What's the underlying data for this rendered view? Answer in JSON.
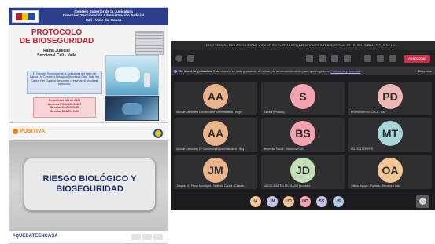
{
  "slide1": {
    "header_lines": [
      "Consejo Superior de la Judicatura",
      "Dirección Seccional de Administración Judicial",
      "Cali - Valle del Cauca"
    ],
    "title_lines": [
      "PROTOCOLO",
      "DE BIOSEGURIDAD"
    ],
    "rama_lines": [
      "Rama Judicial",
      "Seccional Cali - Valle"
    ],
    "blue_box_text": "El Consejo Seccional de la Judicatura del Valle del Cauca - la Dirección Ejecutiva Seccional Cali - Valle del Cauca Y el Copasst Seccional, presentan el siguiente protocolo.",
    "pink_box_lines": [
      "Resolución 666 de 2020",
      "Acuerdo PCSJA20-11567",
      "Circular COJUC20-35",
      "Circular DEAJC20-30"
    ]
  },
  "slide2": {
    "brand": "POSITIVA",
    "card_lines": [
      "RIESGO BIOLÓGICO Y",
      "BIOSEGURIDAD"
    ],
    "hashtag": "#QUEDATEENCASA"
  },
  "meeting": {
    "title": "DÍA 4 SEMANA DE LA SEGURIDAD Y SALUD EN EL TRABAJO (RELACIONES INTERPERSONALES / BUENAS PRACTICAS DE HIG...",
    "leave_label": "Abandonar",
    "banner": {
      "bold": "Se inició la grabación.",
      "text": " Esta reunión se está grabando. Al unirse, da su consentimiento para que lo graben.",
      "link": "Política de privacidad",
      "dismiss": "Descartar"
    },
    "participants": [
      {
        "initials": "AA",
        "color": "#e8b48c",
        "name": "Auxiliar Laborales Construcción Administrativa - Bogo..."
      },
      {
        "initials": "S",
        "color": "#f2a3ad",
        "name": "Sandra (Invitado)"
      },
      {
        "initials": "PD",
        "color": "#f0b7b7",
        "name": "Profesional HIG CPLA - Cali"
      },
      {
        "initials": "AA",
        "color": "#e8b48c",
        "name": "Auxiliar Laborales 02 Construcción Administrativa - Bog..."
      },
      {
        "initials": "BS",
        "color": "#f2a3ad",
        "name": "Bienestar Social - Seccional Cali"
      },
      {
        "initials": "MT",
        "color": "#a9d6d8",
        "name": "MILENA TORRES"
      },
      {
        "initials": "JM",
        "color": "#e8b48c",
        "name": "Juzgado 07 Penal Municipal - Valle del Cauca - Cascab..."
      },
      {
        "initials": "JD",
        "color": "#c3ddb4",
        "name": "MARIO MARTIN DELGADO (Invitado)"
      },
      {
        "initials": "OA",
        "color": "#f3c594",
        "name": "Oficina Apoyo - Palmira - Seccional Cali"
      }
    ],
    "chips": [
      {
        "initials": "IA",
        "color": "#f3c594"
      },
      {
        "initials": "JM",
        "color": "#c8c3ea"
      },
      {
        "initials": "UO",
        "color": "#f3c594"
      },
      {
        "initials": "UO",
        "color": "#f2a3ad"
      },
      {
        "initials": "SS",
        "color": "#c8c3ea"
      },
      {
        "initials": "JS",
        "color": "#a9c8ea"
      }
    ]
  }
}
